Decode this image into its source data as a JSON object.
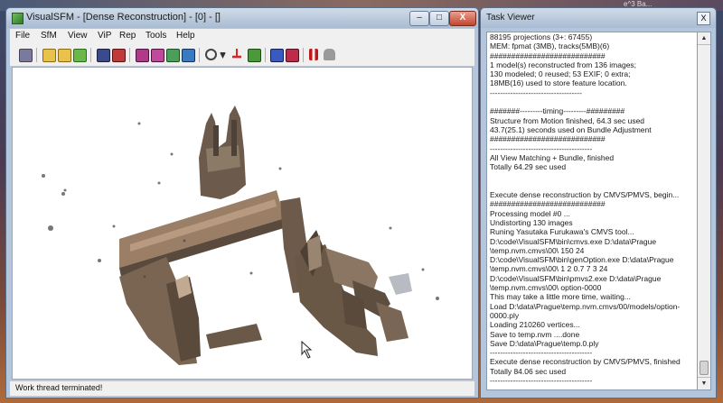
{
  "desktop": {
    "corner_text": "e^3 Ba..."
  },
  "main_window": {
    "title": "VisualSFM - [Dense Reconstruction] - [0] - []",
    "caption_buttons": {
      "minimize": "–",
      "maximize": "□",
      "close": "X"
    },
    "menu": [
      "File",
      "SfM",
      "View",
      "ViP",
      "Rep",
      "Tools",
      "Help"
    ],
    "toolbar_icons": [
      "new-icon",
      "open-icon",
      "open-multi-icon",
      "open-folder-icon",
      "save-icon",
      "copy-icon",
      "pair-match-icon",
      "match-icon",
      "match-alt-icon",
      "compute-icon",
      "zoom-icon",
      "dropdown-icon",
      "tree-icon",
      "lock-icon",
      "sparse-icon",
      "dense-icon",
      "pause-icon",
      "hand-icon"
    ],
    "status": "Work thread terminated!"
  },
  "task_viewer": {
    "title": "Task Viewer",
    "close_label": "X",
    "scroll_up": "▲",
    "scroll_down": "▼",
    "log_lines": [
      "88195 projections (3+: 67455)",
      "MEM: fpmat (3MB), tracks(5MB)(6)",
      "###########################",
      "1 model(s) reconstructed from 136 images;",
      "130 modeled; 0 reused; 53 EXIF; 0 extra;",
      "18MB(16) used to store feature location.",
      "------------------------------------",
      "",
      "#######---------timing---------#########",
      "Structure from Motion finished, 64.3 sec used",
      "43.7(25.1) seconds used on Bundle Adjustment",
      "###########################",
      "----------------------------------------",
      "All View Matching + Bundle, finished",
      "Totally 64.29 sec used",
      "",
      "",
      "Execute dense reconstruction by CMVS/PMVS, begin...",
      "###########################",
      "Processing model #0 ...",
      "Undistorting 130 images",
      "Runing Yasutaka Furukawa's CMVS tool...",
      "D:\\code\\VisualSFM\\bin\\cmvs.exe D:\\data\\Prague",
      "\\temp.nvm.cmvs\\00\\ 150 24",
      "D:\\code\\VisualSFM\\bin\\genOption.exe D:\\data\\Prague",
      "\\temp.nvm.cmvs\\00\\ 1 2 0.7 7 3 24",
      "D:\\code\\VisualSFM\\bin\\pmvs2.exe D:\\data\\Prague",
      "\\temp.nvm.cmvs\\00\\ option-0000",
      "This may take a little more time, waiting...",
      "Load D:\\data\\Prague\\temp.nvm.cmvs/00/models/option-",
      "0000.ply",
      "Loading 210260 vertices...",
      "Save to temp.nvm ....done",
      "Save D:\\data\\Prague\\temp.0.ply",
      "----------------------------------------",
      "Execute dense reconstruction by CMVS/PMVS, finished",
      "Totally 84.06 sec used",
      "----------------------------------------"
    ]
  }
}
